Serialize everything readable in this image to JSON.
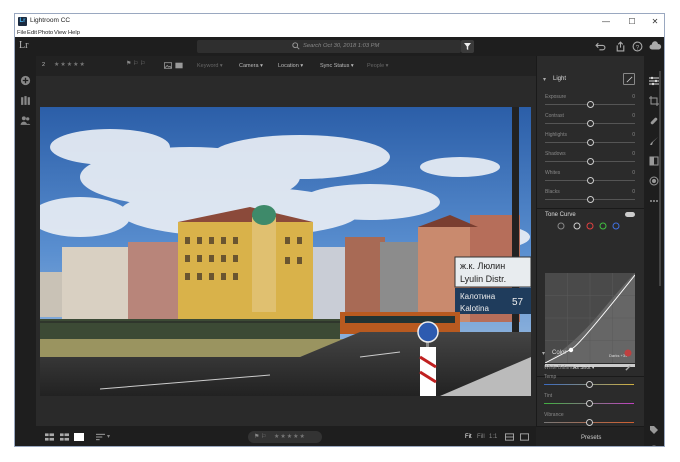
{
  "window": {
    "title": "Lightroom CC",
    "app_icon": "Lr",
    "controls": [
      "—",
      "☐",
      "✕"
    ]
  },
  "menubar": [
    "File",
    "Edit",
    "Photo",
    "View",
    "Help"
  ],
  "appbar": {
    "logo": "Lr",
    "search_placeholder": "Search Oct 30, 2018 1:03 PM"
  },
  "filterbar": {
    "count": "2",
    "stars": "★★★★★",
    "keyword": "Keyword",
    "camera": "Camera",
    "location": "Location",
    "sync_status": "Sync Status",
    "people": "People"
  },
  "photo": {
    "sign_line1": "ж.к. Люлин",
    "sign_line2": "Lyulin Distr.",
    "sign_line3": "Калотина",
    "sign_line4": "Kalotina",
    "sign_number": "57"
  },
  "bottombar": {
    "stars": "★★★★★",
    "fit": "Fit",
    "fill": "Fill",
    "one_to_one": "1:1"
  },
  "light_panel": {
    "title": "Light",
    "sliders": [
      {
        "label": "Exposure",
        "value": "0",
        "level": 0.5
      },
      {
        "label": "Contrast",
        "value": "0",
        "level": 0.5
      },
      {
        "label": "Highlights",
        "value": "0",
        "level": 0.5
      },
      {
        "label": "Shadows",
        "value": "0",
        "level": 0.5
      },
      {
        "label": "Whites",
        "value": "0",
        "level": 0.5
      },
      {
        "label": "Blacks",
        "value": "0",
        "level": 0.5
      }
    ]
  },
  "tone_curve": {
    "title": "Tone Curve",
    "readout": "Darks  +34"
  },
  "color_panel": {
    "title": "Color",
    "white_balance_label": "White Balance",
    "white_balance_value": "As Shot",
    "sliders": [
      {
        "label": "Temp",
        "value": "",
        "level": 0.5
      },
      {
        "label": "Tint",
        "value": "",
        "level": 0.5
      },
      {
        "label": "Vibrance",
        "value": "",
        "level": 0.5
      }
    ]
  },
  "presets_label": "Presets",
  "colors": {
    "accent": "#4bb8f5"
  }
}
